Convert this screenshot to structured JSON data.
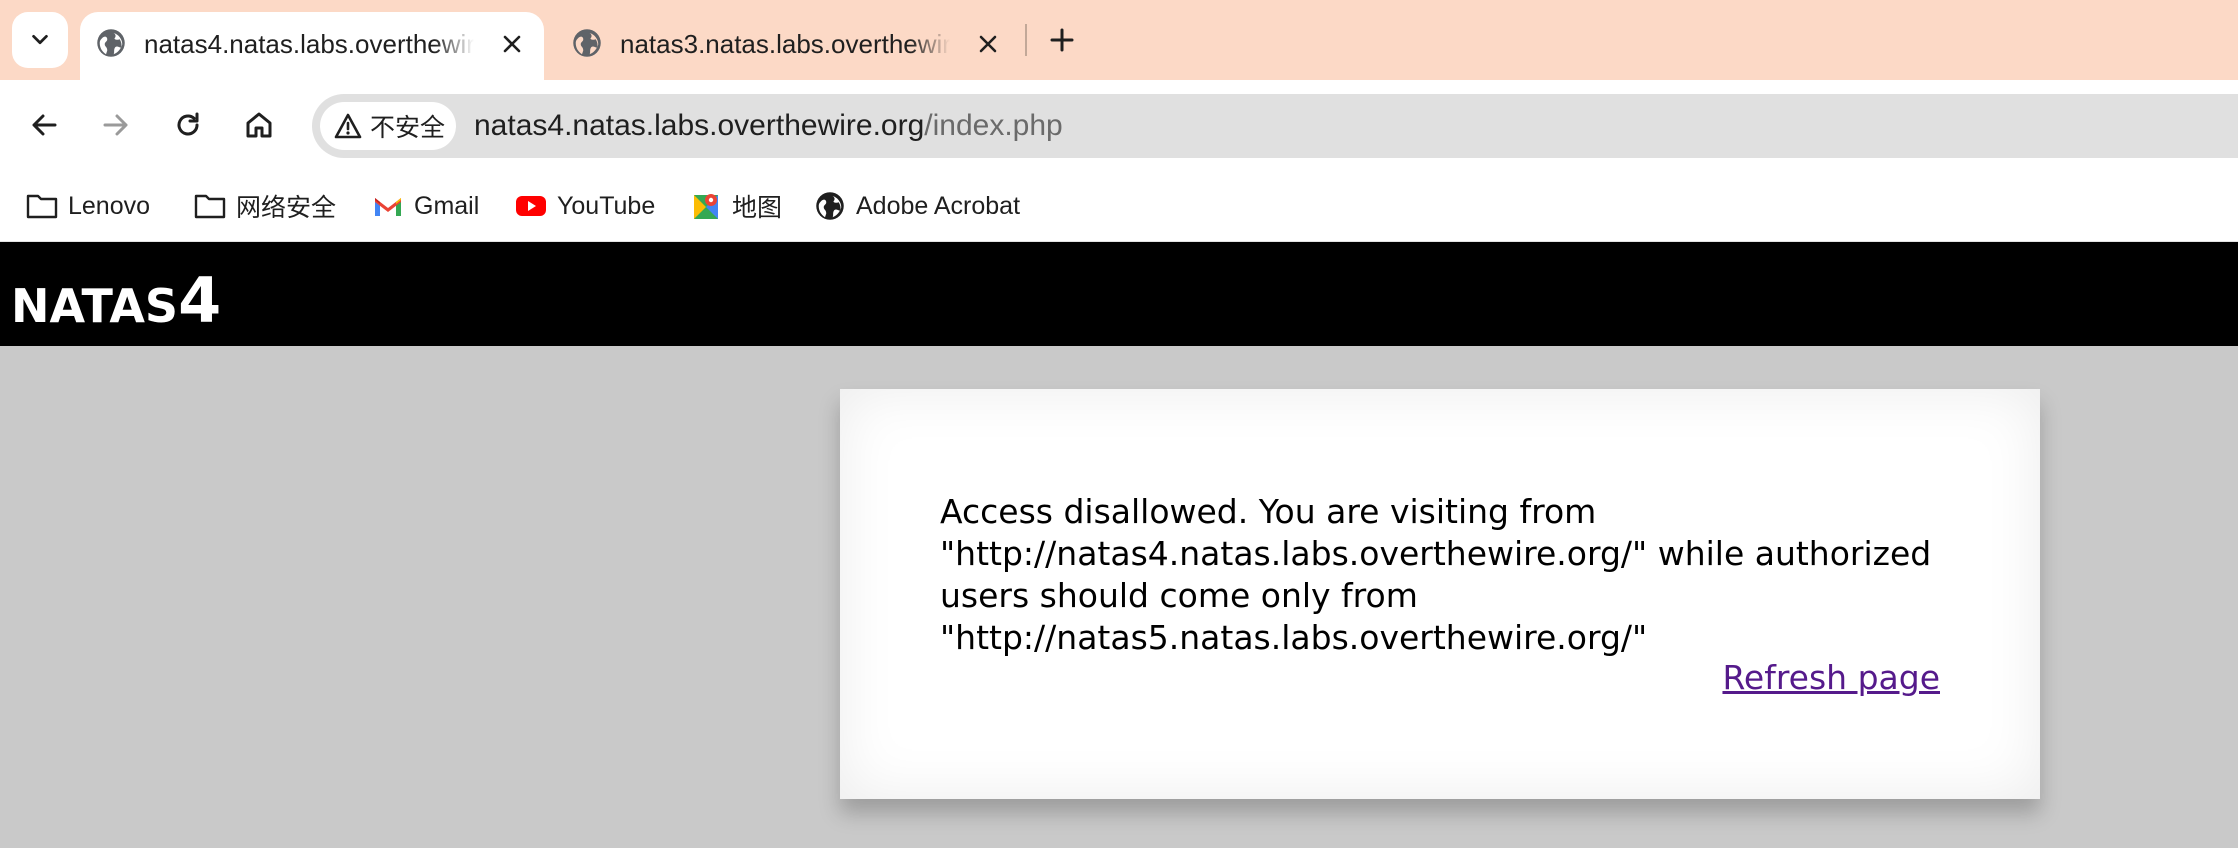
{
  "browser": {
    "tabs": [
      {
        "title": "natas4.natas.labs.overthewire.org",
        "active": true
      },
      {
        "title": "natas3.natas.labs.overthewire.org",
        "active": false
      }
    ],
    "security_label": "不安全",
    "url_host": "natas4.natas.labs.overthewire.org",
    "url_path": "/index.php",
    "bookmarks": [
      {
        "label": "Lenovo",
        "icon": "folder-icon"
      },
      {
        "label": "网络安全",
        "icon": "folder-icon"
      },
      {
        "label": "Gmail",
        "icon": "gmail-icon"
      },
      {
        "label": "YouTube",
        "icon": "youtube-icon"
      },
      {
        "label": "地图",
        "icon": "maps-icon"
      },
      {
        "label": "Adobe Acrobat",
        "icon": "globe-icon"
      }
    ]
  },
  "page": {
    "header_word": "NATAS",
    "header_number": "4",
    "message_lines": [
      "Access disallowed. You are visiting from",
      "\"http://natas4.natas.labs.overthewire.org/\" while authorized",
      "users should come only from",
      "\"http://natas5.natas.labs.overthewire.org/\""
    ],
    "refresh_link": "Refresh page"
  },
  "colors": {
    "tabstrip_bg": "#fcd9c6",
    "omnibox_bg": "#e0e0e0",
    "page_bg": "#c9c9c9",
    "header_bg": "#000000",
    "link_visited": "#551a8b"
  }
}
